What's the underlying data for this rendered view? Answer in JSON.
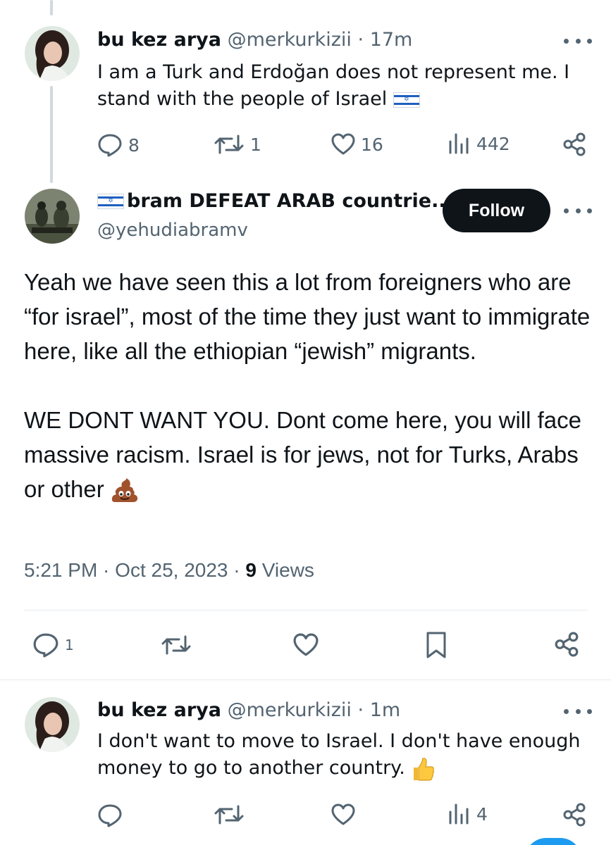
{
  "tweet1": {
    "display_name": "bu kez arya",
    "handle": "@merkurkizii",
    "separator": "·",
    "time": "17m",
    "text": "I am a Turk and Erdoğan does not represent me. I stand with the people of Israel",
    "flag_icon": "israel-flag-icon",
    "replies": "8",
    "retweets": "1",
    "likes": "16",
    "views": "442"
  },
  "main_tweet": {
    "display_name": "bram DEFEAT ARAB countrie...",
    "handle": "@yehudiabramv",
    "follow_label": "Follow",
    "text": "Yeah we have seen this a lot from foreigners who are “for israel”, most of the time they just want to immigrate here, like all the ethiopian “jewish” migrants.\n\nWE DONT WANT YOU. Dont come here, you will face massive racism. Israel is for jews, not for Turks, Arabs or other",
    "emoji_icon": "pile-of-poo-icon",
    "timestamp": "5:21 PM · Oct 25, 2023 · ",
    "views_count": "9",
    "views_label": " Views",
    "replies": "1"
  },
  "tweet2": {
    "display_name": "bu kez arya",
    "handle": "@merkurkizii",
    "separator": "·",
    "time": "1m",
    "text": "I don't want to move to Israel. I don't have enough money to go to another country.",
    "emoji_icon": "thumbs-up-icon",
    "views": "4"
  },
  "colors": {
    "text": "#0f1419",
    "secondary": "#536471",
    "follow_bg": "#0f1419",
    "accent": "#1d9bf0"
  }
}
